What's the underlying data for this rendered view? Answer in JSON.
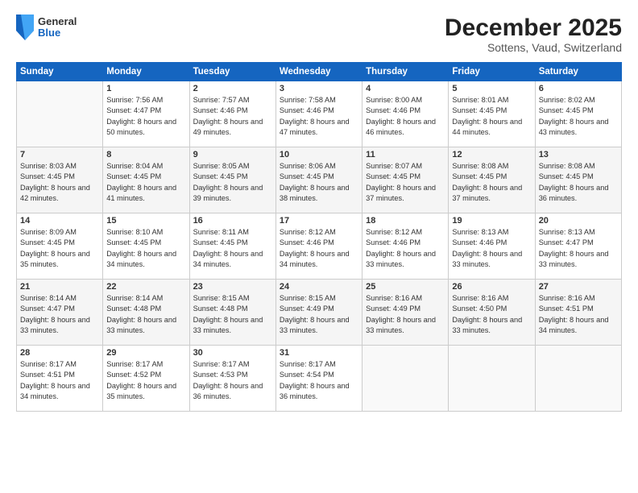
{
  "header": {
    "logo": {
      "general": "General",
      "blue": "Blue"
    },
    "title": "December 2025",
    "location": "Sottens, Vaud, Switzerland"
  },
  "weekdays": [
    "Sunday",
    "Monday",
    "Tuesday",
    "Wednesday",
    "Thursday",
    "Friday",
    "Saturday"
  ],
  "weeks": [
    [
      {
        "day": "",
        "sunrise": "",
        "sunset": "",
        "daylight": ""
      },
      {
        "day": "1",
        "sunrise": "Sunrise: 7:56 AM",
        "sunset": "Sunset: 4:47 PM",
        "daylight": "Daylight: 8 hours and 50 minutes."
      },
      {
        "day": "2",
        "sunrise": "Sunrise: 7:57 AM",
        "sunset": "Sunset: 4:46 PM",
        "daylight": "Daylight: 8 hours and 49 minutes."
      },
      {
        "day": "3",
        "sunrise": "Sunrise: 7:58 AM",
        "sunset": "Sunset: 4:46 PM",
        "daylight": "Daylight: 8 hours and 47 minutes."
      },
      {
        "day": "4",
        "sunrise": "Sunrise: 8:00 AM",
        "sunset": "Sunset: 4:46 PM",
        "daylight": "Daylight: 8 hours and 46 minutes."
      },
      {
        "day": "5",
        "sunrise": "Sunrise: 8:01 AM",
        "sunset": "Sunset: 4:45 PM",
        "daylight": "Daylight: 8 hours and 44 minutes."
      },
      {
        "day": "6",
        "sunrise": "Sunrise: 8:02 AM",
        "sunset": "Sunset: 4:45 PM",
        "daylight": "Daylight: 8 hours and 43 minutes."
      }
    ],
    [
      {
        "day": "7",
        "sunrise": "Sunrise: 8:03 AM",
        "sunset": "Sunset: 4:45 PM",
        "daylight": "Daylight: 8 hours and 42 minutes."
      },
      {
        "day": "8",
        "sunrise": "Sunrise: 8:04 AM",
        "sunset": "Sunset: 4:45 PM",
        "daylight": "Daylight: 8 hours and 41 minutes."
      },
      {
        "day": "9",
        "sunrise": "Sunrise: 8:05 AM",
        "sunset": "Sunset: 4:45 PM",
        "daylight": "Daylight: 8 hours and 39 minutes."
      },
      {
        "day": "10",
        "sunrise": "Sunrise: 8:06 AM",
        "sunset": "Sunset: 4:45 PM",
        "daylight": "Daylight: 8 hours and 38 minutes."
      },
      {
        "day": "11",
        "sunrise": "Sunrise: 8:07 AM",
        "sunset": "Sunset: 4:45 PM",
        "daylight": "Daylight: 8 hours and 37 minutes."
      },
      {
        "day": "12",
        "sunrise": "Sunrise: 8:08 AM",
        "sunset": "Sunset: 4:45 PM",
        "daylight": "Daylight: 8 hours and 37 minutes."
      },
      {
        "day": "13",
        "sunrise": "Sunrise: 8:08 AM",
        "sunset": "Sunset: 4:45 PM",
        "daylight": "Daylight: 8 hours and 36 minutes."
      }
    ],
    [
      {
        "day": "14",
        "sunrise": "Sunrise: 8:09 AM",
        "sunset": "Sunset: 4:45 PM",
        "daylight": "Daylight: 8 hours and 35 minutes."
      },
      {
        "day": "15",
        "sunrise": "Sunrise: 8:10 AM",
        "sunset": "Sunset: 4:45 PM",
        "daylight": "Daylight: 8 hours and 34 minutes."
      },
      {
        "day": "16",
        "sunrise": "Sunrise: 8:11 AM",
        "sunset": "Sunset: 4:45 PM",
        "daylight": "Daylight: 8 hours and 34 minutes."
      },
      {
        "day": "17",
        "sunrise": "Sunrise: 8:12 AM",
        "sunset": "Sunset: 4:46 PM",
        "daylight": "Daylight: 8 hours and 34 minutes."
      },
      {
        "day": "18",
        "sunrise": "Sunrise: 8:12 AM",
        "sunset": "Sunset: 4:46 PM",
        "daylight": "Daylight: 8 hours and 33 minutes."
      },
      {
        "day": "19",
        "sunrise": "Sunrise: 8:13 AM",
        "sunset": "Sunset: 4:46 PM",
        "daylight": "Daylight: 8 hours and 33 minutes."
      },
      {
        "day": "20",
        "sunrise": "Sunrise: 8:13 AM",
        "sunset": "Sunset: 4:47 PM",
        "daylight": "Daylight: 8 hours and 33 minutes."
      }
    ],
    [
      {
        "day": "21",
        "sunrise": "Sunrise: 8:14 AM",
        "sunset": "Sunset: 4:47 PM",
        "daylight": "Daylight: 8 hours and 33 minutes."
      },
      {
        "day": "22",
        "sunrise": "Sunrise: 8:14 AM",
        "sunset": "Sunset: 4:48 PM",
        "daylight": "Daylight: 8 hours and 33 minutes."
      },
      {
        "day": "23",
        "sunrise": "Sunrise: 8:15 AM",
        "sunset": "Sunset: 4:48 PM",
        "daylight": "Daylight: 8 hours and 33 minutes."
      },
      {
        "day": "24",
        "sunrise": "Sunrise: 8:15 AM",
        "sunset": "Sunset: 4:49 PM",
        "daylight": "Daylight: 8 hours and 33 minutes."
      },
      {
        "day": "25",
        "sunrise": "Sunrise: 8:16 AM",
        "sunset": "Sunset: 4:49 PM",
        "daylight": "Daylight: 8 hours and 33 minutes."
      },
      {
        "day": "26",
        "sunrise": "Sunrise: 8:16 AM",
        "sunset": "Sunset: 4:50 PM",
        "daylight": "Daylight: 8 hours and 33 minutes."
      },
      {
        "day": "27",
        "sunrise": "Sunrise: 8:16 AM",
        "sunset": "Sunset: 4:51 PM",
        "daylight": "Daylight: 8 hours and 34 minutes."
      }
    ],
    [
      {
        "day": "28",
        "sunrise": "Sunrise: 8:17 AM",
        "sunset": "Sunset: 4:51 PM",
        "daylight": "Daylight: 8 hours and 34 minutes."
      },
      {
        "day": "29",
        "sunrise": "Sunrise: 8:17 AM",
        "sunset": "Sunset: 4:52 PM",
        "daylight": "Daylight: 8 hours and 35 minutes."
      },
      {
        "day": "30",
        "sunrise": "Sunrise: 8:17 AM",
        "sunset": "Sunset: 4:53 PM",
        "daylight": "Daylight: 8 hours and 36 minutes."
      },
      {
        "day": "31",
        "sunrise": "Sunrise: 8:17 AM",
        "sunset": "Sunset: 4:54 PM",
        "daylight": "Daylight: 8 hours and 36 minutes."
      },
      {
        "day": "",
        "sunrise": "",
        "sunset": "",
        "daylight": ""
      },
      {
        "day": "",
        "sunrise": "",
        "sunset": "",
        "daylight": ""
      },
      {
        "day": "",
        "sunrise": "",
        "sunset": "",
        "daylight": ""
      }
    ]
  ]
}
